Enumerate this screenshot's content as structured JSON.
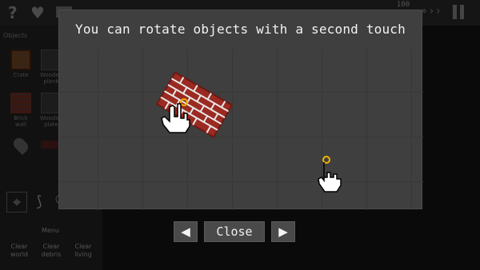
{
  "topbar": {
    "help_icon": "?",
    "heart_icon": "♥",
    "speed_label": "100",
    "fast_forward_icon": "›››"
  },
  "left_panel": {
    "title": "Objects",
    "items": [
      {
        "label": "Crate",
        "icon": "crate-icon"
      },
      {
        "label": "Wooden\nplank",
        "icon": "plank-icon"
      },
      {
        "label": "Brick\nwall",
        "icon": "brick-icon"
      },
      {
        "label": "Wooden\nplate",
        "icon": "plate-icon"
      },
      {
        "label": "",
        "icon": "pin-icon"
      }
    ],
    "menu_label": "Menu",
    "clear_buttons": [
      "Clear\nworld",
      "Clear\ndebris",
      "Clear\nliving"
    ]
  },
  "dialog": {
    "title": "You can rotate objects with a second touch",
    "touch_color": "#f0b400",
    "brick_color": "#9b2b22"
  },
  "nav": {
    "prev_icon": "◀",
    "close_label": "Close",
    "next_icon": "▶"
  }
}
